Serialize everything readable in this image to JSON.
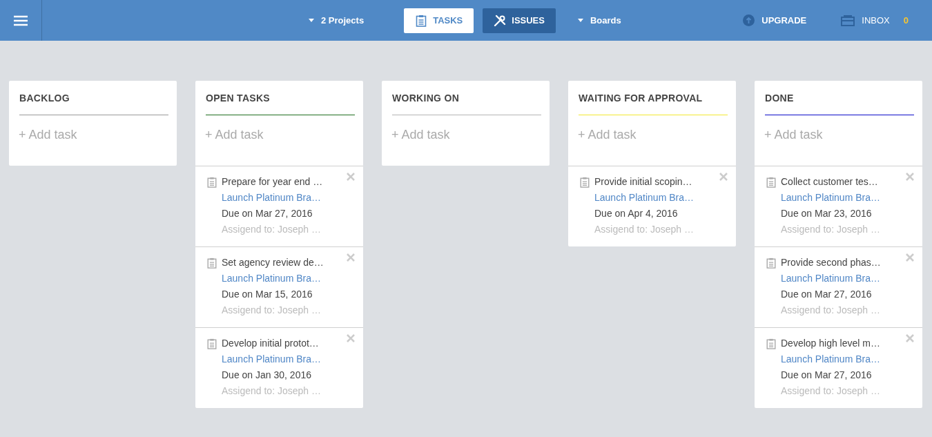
{
  "header": {
    "projects": "2 Projects",
    "tabs": [
      {
        "label": "TASKS",
        "kind": "tasks",
        "selected": true
      },
      {
        "label": "ISSUES",
        "kind": "issues",
        "selected": false
      }
    ],
    "boards": "Boards",
    "upgrade": "UPGRADE",
    "inbox": {
      "label": "INBOX",
      "count": "0"
    }
  },
  "columns": [
    {
      "title": "BACKLOG",
      "color": "#9a9a9a",
      "add": "+ Add task"
    },
    {
      "title": "OPEN TASKS",
      "color": "#1e6e1e",
      "add": "+ Add task",
      "tasks": [
        {
          "title": "Prepare for year end …",
          "project": "Launch Platinum Bra…",
          "due": "Due on Mar 27, 2016",
          "assignee": "Assigend to: Joseph …"
        },
        {
          "title": "Set agency review de…",
          "project": "Launch Platinum Bra…",
          "due": "Due on Mar 15, 2016",
          "assignee": "Assigend to: Joseph …"
        },
        {
          "title": "Develop initial protot…",
          "project": "Launch Platinum Bra…",
          "due": "Due on Jan 30, 2016",
          "assignee": "Assigend to: Joseph …"
        }
      ]
    },
    {
      "title": "WORKING ON",
      "color": "#b4b4b4",
      "add": "+ Add task"
    },
    {
      "title": "WAITING FOR APPROVAL",
      "color": "#f2e830",
      "add": "+ Add task",
      "tasks": [
        {
          "title": "Provide initial scopin…",
          "project": "Launch Platinum Bra…",
          "due": "Due on Apr 4, 2016",
          "assignee": "Assigend to: Joseph …"
        }
      ]
    },
    {
      "title": "DONE",
      "color": "#0a0ac8",
      "add": "+ Add task",
      "tasks": [
        {
          "title": "Collect customer tes…",
          "project": "Launch Platinum Bra…",
          "due": "Due on Mar 23, 2016",
          "assignee": "Assigend to: Joseph …"
        },
        {
          "title": "Provide second phas…",
          "project": "Launch Platinum Bra…",
          "due": "Due on Mar 27, 2016",
          "assignee": "Assigend to: Joseph …"
        },
        {
          "title": "Develop high level m…",
          "project": "Launch Platinum Bra…",
          "due": "Due on Mar 27, 2016",
          "assignee": "Assigend to: Joseph …"
        }
      ]
    }
  ]
}
